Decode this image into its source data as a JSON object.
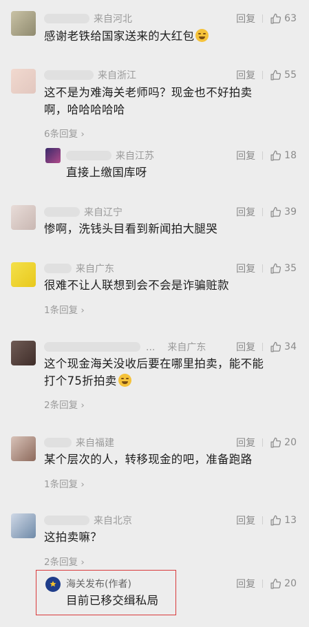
{
  "reply_label": "回复",
  "comments": [
    {
      "loc": "来自河北",
      "likes": "63",
      "text": "感谢老铁给国家送来的大红包",
      "emoji": true
    },
    {
      "loc": "来自浙江",
      "likes": "55",
      "text_lines": [
        "这不是为难海关老师吗？现金也不好拍卖",
        "啊，哈哈哈哈哈"
      ],
      "more": "6条回复 ›",
      "reply": {
        "loc": "来自江苏",
        "likes": "18",
        "text": "直接上缴国库呀"
      }
    },
    {
      "loc": "来自辽宁",
      "likes": "39",
      "text": "惨啊，洗钱头目看到新闻拍大腿哭"
    },
    {
      "loc": "来自广东",
      "likes": "35",
      "text": "很难不让人联想到会不会是诈骗赃款",
      "more": "1条回复 ›"
    },
    {
      "loc": "来自广东",
      "likes": "34",
      "ellipsis": "...",
      "text_lines": [
        "这个现金海关没收后要在哪里拍卖，能不能",
        "打个75折拍卖"
      ],
      "emoji": true,
      "more": "2条回复 ›"
    },
    {
      "loc": "来自福建",
      "likes": "20",
      "text": "某个层次的人，转移现金的吧，准备跑路",
      "more": "1条回复 ›"
    },
    {
      "loc": "来自北京",
      "likes": "13",
      "text": "这拍卖嘛？",
      "more": "2条回复 ›",
      "reply": {
        "name": "海关发布(作者)",
        "likes": "20",
        "text": "目前已移交缉私局"
      }
    }
  ],
  "colors": {
    "background": "#ededed",
    "highlight_border": "#d9383a",
    "meta_text": "#8a8a8a"
  },
  "icons": [
    "thumb-up-icon",
    "chevron-right-icon"
  ]
}
